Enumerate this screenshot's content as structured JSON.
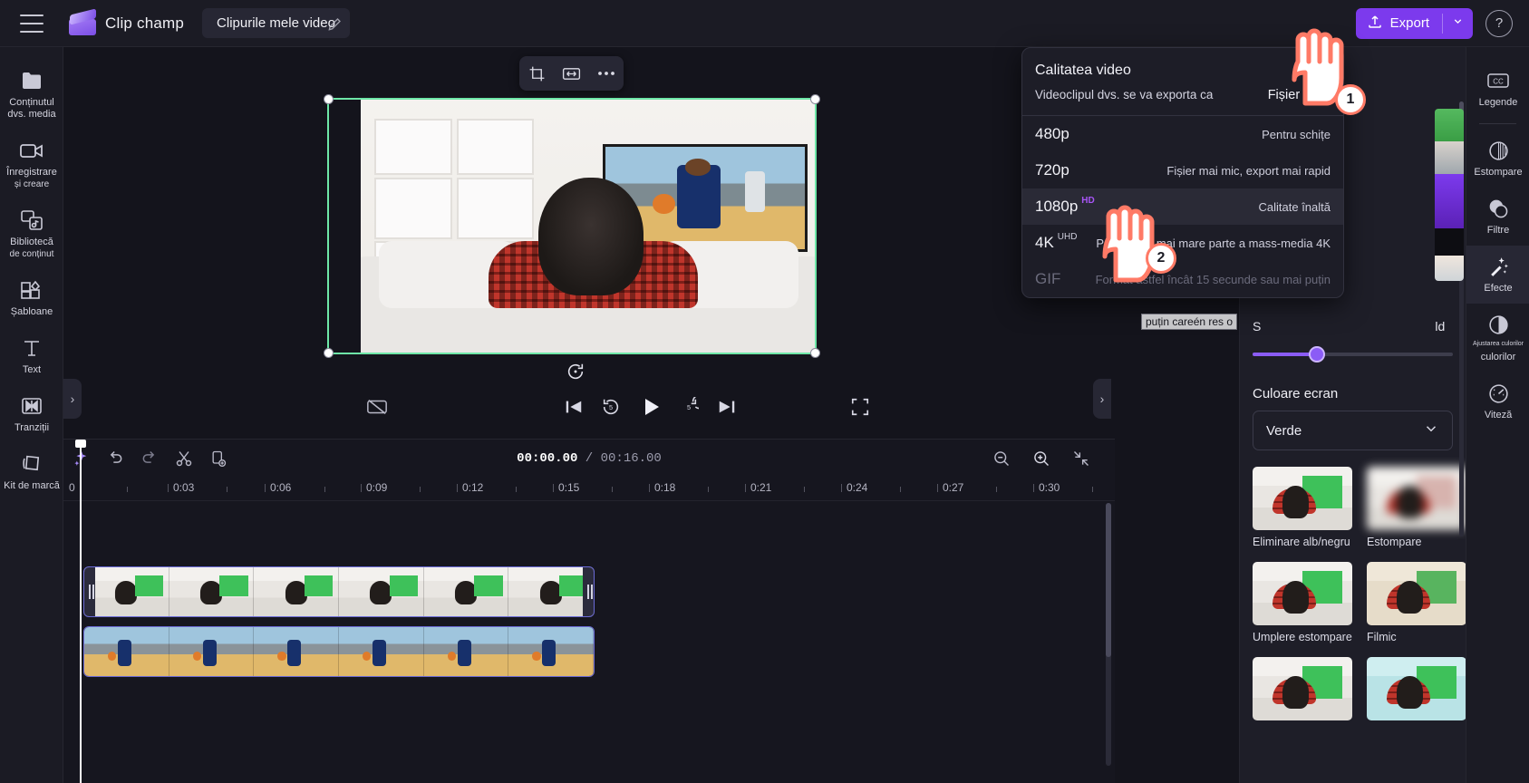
{
  "app": {
    "brand_name": "Clip champ",
    "project_tab": "Clipurile mele video"
  },
  "topbar": {
    "menu_icon": "hamburger-icon",
    "edit_icon": "pencil-icon",
    "export_label": "Export",
    "export_icon": "upload-icon",
    "export_caret": "chevron-down-icon",
    "help_label": "?"
  },
  "left_rail": {
    "items": [
      {
        "icon": "folder-icon",
        "label": "Conținutul dvs. media",
        "sub": ""
      },
      {
        "icon": "video-camera-icon",
        "label": "Înregistrare",
        "sub": "și creare"
      },
      {
        "icon": "content-library-icon",
        "label": "Bibliotecă",
        "sub": "de conținut"
      },
      {
        "icon": "templates-icon",
        "label": "Șabloane",
        "sub": ""
      },
      {
        "icon": "text-icon",
        "label": "Text",
        "sub": ""
      },
      {
        "icon": "transitions-icon",
        "label": "Tranziții",
        "sub": ""
      },
      {
        "icon": "brand-kit-icon",
        "label": "Kit de marcă",
        "sub": ""
      }
    ]
  },
  "right_rail": {
    "items": [
      {
        "icon": "closed-captions-icon",
        "label": "Legende",
        "active": false
      },
      {
        "icon": "fade-icon",
        "label": "Estompare",
        "active": false
      },
      {
        "icon": "filters-icon",
        "label": "Filtre",
        "active": false
      },
      {
        "icon": "effects-magic-wand-icon",
        "label": "Efecte",
        "active": true
      },
      {
        "icon": "color-adjust-icon",
        "label": "Ajustarea culorilor",
        "active": false
      },
      {
        "icon": "speed-gauge-icon",
        "label": "Viteză",
        "active": false
      }
    ],
    "color_adjust_small": "Ajustarea culorilor",
    "color_adjust_big": "culorilor"
  },
  "preview": {
    "float_tools": [
      "crop-icon",
      "fit-icon",
      "more-options-icon"
    ],
    "rotate_icon": "rotate-icon",
    "controls": [
      "no-captions-icon",
      "skip-to-start-icon",
      "rewind-5-icon",
      "play-icon",
      "forward-5-icon",
      "skip-to-end-icon",
      "fullscreen-icon"
    ],
    "collapse_left_icon": "chevron-right-icon",
    "collapse_right_icon": "chevron-right-icon"
  },
  "timeline": {
    "tools": [
      "ai-sparkle-icon",
      "undo-icon",
      "redo-icon",
      "split-scissors-icon",
      "duplicate-icon"
    ],
    "current_time": "00:00.00",
    "separator": "/",
    "total_time": "00:16.00",
    "right_tools": [
      "zoom-out-icon",
      "zoom-in-icon",
      "fit-timeline-icon"
    ],
    "ruler_ticks": [
      "0",
      "0:03",
      "0:06",
      "0:09",
      "0:12",
      "0:15",
      "0:18",
      "0:21",
      "0:24",
      "0:27",
      "0:30"
    ],
    "tracks": [
      {
        "name": "video-track-overlay",
        "thumbs": 6
      },
      {
        "name": "video-track-background",
        "thumbs": 6
      }
    ]
  },
  "effects_panel": {
    "slider_label_left": "S",
    "slider_label_right": "ld",
    "tooltip_text": "puțin careén res o",
    "slider_value_pct": 30,
    "screen_color_title": "Culoare ecran",
    "screen_color_value": "Verde",
    "dropdown_icon": "chevron-down-icon",
    "effects": [
      {
        "name": "Eliminare alb/negru",
        "style": "normal"
      },
      {
        "name": "Estompare",
        "style": "blurred"
      },
      {
        "name": "Umplere estompare",
        "style": "normal"
      },
      {
        "name": "Filmic",
        "style": "film"
      },
      {
        "name": "",
        "style": "normal"
      },
      {
        "name": "",
        "style": "teal"
      }
    ],
    "accent_color": "#8b5cf6"
  },
  "export_menu": {
    "title": "Calitatea video",
    "subtitle": "Videoclipul dvs. se va exporta ca",
    "format": "Fișier MP4",
    "options": [
      {
        "res": "480p",
        "badge": "",
        "desc": "Pentru schițe",
        "selected": false,
        "disabled": false
      },
      {
        "res": "720p",
        "badge": "",
        "desc": "Fișier mai mic, export mai rapid",
        "selected": false,
        "disabled": false
      },
      {
        "res": "1080p",
        "badge": "HD",
        "desc": "Calitate înaltă",
        "selected": true,
        "disabled": false
      },
      {
        "res": "4K",
        "badge": "UHD",
        "desc": "Pentru cea mai mare parte a mass-media 4K",
        "selected": false,
        "disabled": false
      },
      {
        "res": "GIF",
        "badge": "",
        "desc": "Format astfel încât 15 secunde sau mai puțin",
        "selected": false,
        "disabled": true
      }
    ]
  },
  "callouts": {
    "step1": "1",
    "step2": "2"
  },
  "colors": {
    "accent": "#7c3aed",
    "selection": "#6ee7a8",
    "callout": "#ff7a66"
  }
}
